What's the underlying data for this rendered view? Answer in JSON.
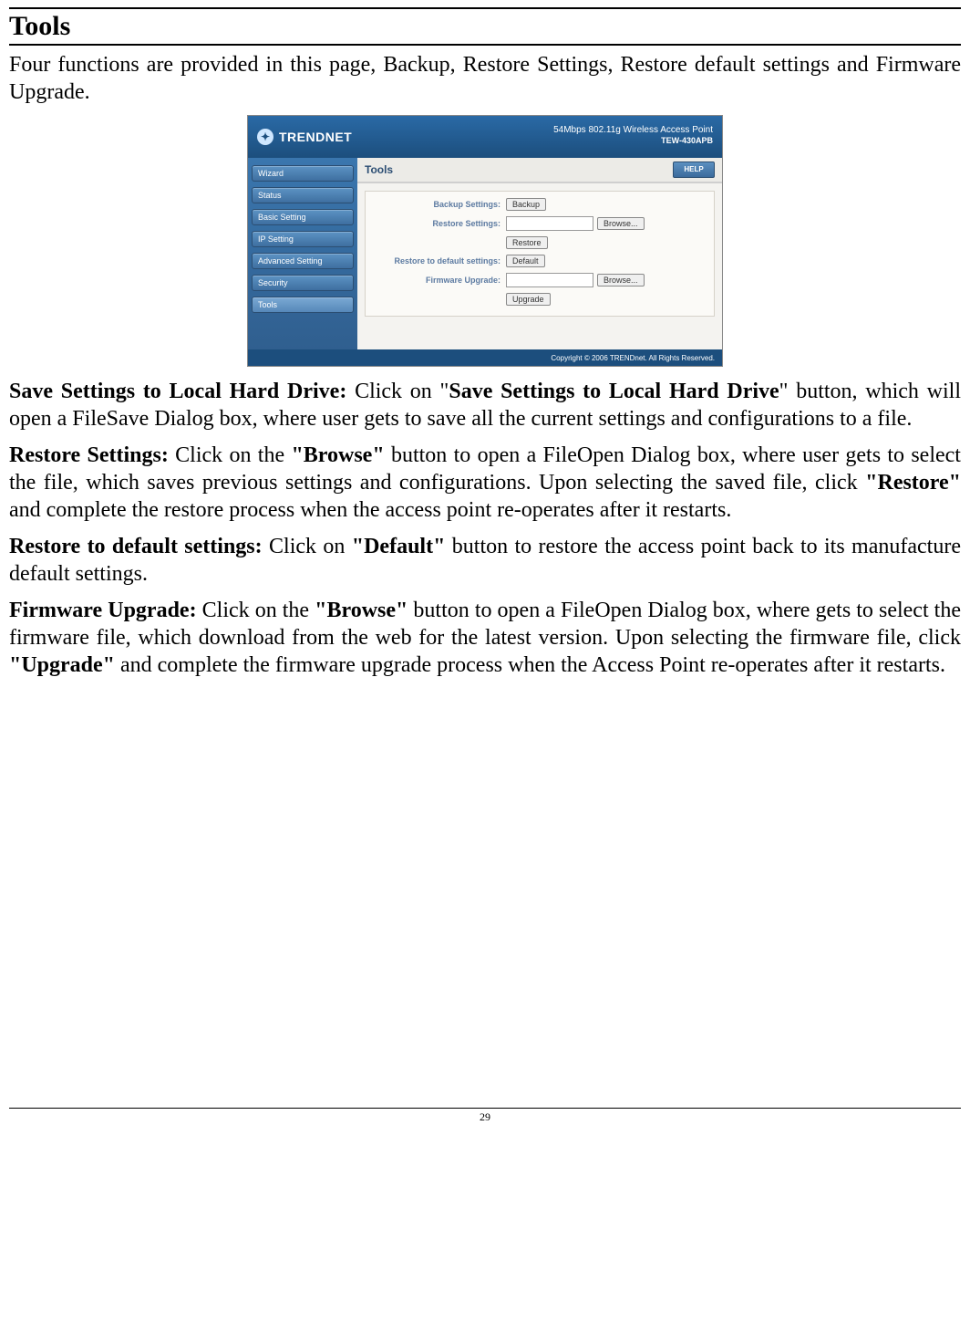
{
  "page": {
    "title": "Tools",
    "intro": "Four functions are provided in this page, Backup, Restore Settings, Restore default settings and Firmware Upgrade.",
    "number": "29"
  },
  "shot": {
    "brand": "TRENDNET",
    "tagline": "54Mbps 802.11g Wireless Access Point",
    "model": "TEW-430APB",
    "nav": [
      "Wizard",
      "Status",
      "Basic Setting",
      "IP Setting",
      "Advanced Setting",
      "Security",
      "Tools"
    ],
    "tools_label": "Tools",
    "help": "HELP",
    "rows": {
      "backup_label": "Backup Settings:",
      "backup_btn": "Backup",
      "restore_label": "Restore Settings:",
      "browse_btn": "Browse...",
      "restore_btn": "Restore",
      "default_label": "Restore to default settings:",
      "default_btn": "Default",
      "firmware_label": "Firmware Upgrade:",
      "upgrade_btn": "Upgrade"
    },
    "footer": "Copyright © 2006 TRENDnet. All Rights Reserved."
  },
  "para_save": {
    "lead": "Save Settings to Local Hard Drive: ",
    "t1": "Click on \"",
    "bold1": "Save Settings to Local Hard Drive",
    "t2": "\" button, which will open a FileSave Dialog box, where user gets to save all the current settings and configurations to a file."
  },
  "para_restore": {
    "lead": "Restore Settings: ",
    "t1": "Click on the ",
    "bold1": "\"Browse\"",
    "t2": " button to open a FileOpen Dialog box, where user gets to select the file, which saves previous settings and configurations. Upon selecting the saved file, click ",
    "bold2": "\"Restore\"",
    "t3": " and complete the restore process when the access point re-operates after it restarts."
  },
  "para_default": {
    "lead": "Restore to default settings: ",
    "t1": "Click on ",
    "bold1": "\"Default\"",
    "t2": " button to restore the access point back to its manufacture default settings."
  },
  "para_firmware": {
    "lead": "Firmware Upgrade: ",
    "t1": "Click on the ",
    "bold1": "\"Browse\"",
    "t2": " button to open a FileOpen Dialog box, where gets to select the firmware file, which download from the web for the latest version. Upon selecting the firmware file, click ",
    "bold2": "\"Upgrade\"",
    "t3": " and complete the firmware upgrade process when the Access Point re-operates after it restarts."
  }
}
